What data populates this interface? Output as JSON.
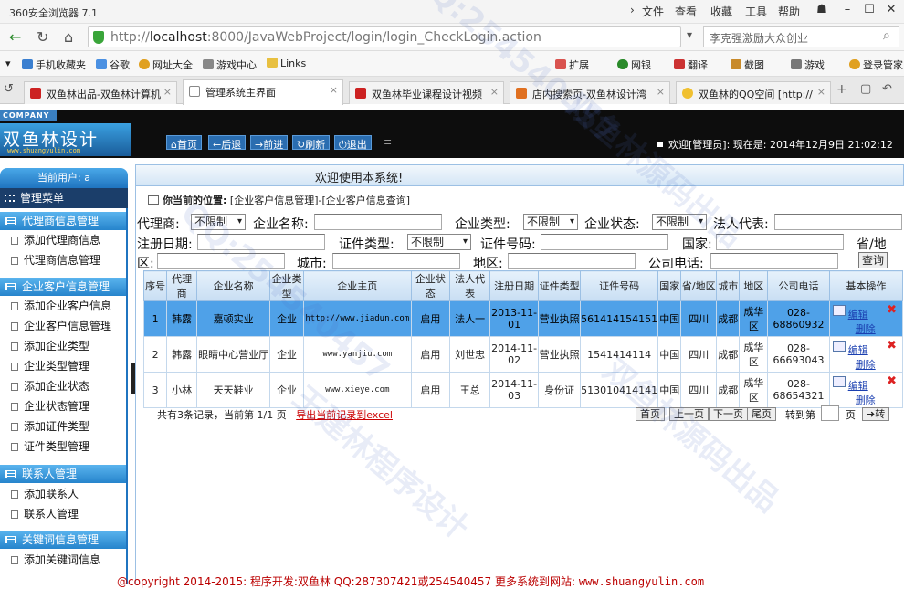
{
  "browser": {
    "title": "360安全浏览器 7.1",
    "menu": [
      "文件",
      "查看",
      "收藏",
      "工具",
      "帮助"
    ],
    "url_prefix": "http://",
    "url_host": "localhost",
    "url_rest": ":8000/JavaWebProject/login/login_CheckLogin.action",
    "search_text": "李克强激励大众创业",
    "bookmarks": [
      "手机收藏夹",
      "谷歌",
      "网址大全",
      "游戏中心",
      "Links"
    ],
    "tools": [
      "扩展",
      "网银",
      "翻译",
      "截图",
      "游戏",
      "登录管家"
    ],
    "tabs": [
      "双鱼林出品-双鱼林计算机",
      "管理系统主界面",
      "双鱼林毕业课程设计视频",
      "店内搜索页-双鱼林设计湾",
      "双鱼林的QQ空间 [http://"
    ]
  },
  "header": {
    "company": "COMPANY",
    "logo_text": "双鱼林设计",
    "logo_url": "www.shuangyulin.com",
    "nav": [
      "首页",
      "后退",
      "前进",
      "刷新",
      "退出"
    ],
    "welcome": "欢迎[管理员]:  现在是: 2014年12月9日 21:02:12"
  },
  "sidebar": {
    "current_user": "当前用户: a",
    "menu_title": "管理菜单",
    "sections": [
      {
        "title": "代理商信息管理",
        "items": [
          "添加代理商信息",
          "代理商信息管理"
        ]
      },
      {
        "title": "企业客户信息管理",
        "items": [
          "添加企业客户信息",
          "企业客户信息管理",
          "添加企业类型",
          "企业类型管理",
          "添加企业状态",
          "企业状态管理",
          "添加证件类型",
          "证件类型管理"
        ]
      },
      {
        "title": "联系人管理",
        "items": [
          "添加联系人",
          "联系人管理"
        ]
      },
      {
        "title": "关键词信息管理",
        "items": [
          "添加关键词信息"
        ]
      }
    ]
  },
  "main": {
    "welcome": "欢迎使用本系统!",
    "location_label": "你当前的位置:",
    "location_path": "[企业客户信息管理]-[企业客户信息查询]",
    "filters": {
      "agent": "代理商:",
      "agent_value": "不限制",
      "company_name": "企业名称:",
      "company_type": "企业类型:",
      "company_type_value": "不限制",
      "company_status": "企业状态:",
      "company_status_value": "不限制",
      "legal_rep": "法人代表:",
      "reg_date": "注册日期:",
      "id_type": "证件类型:",
      "id_type_value": "不限制",
      "id_number": "证件号码:",
      "country": "国家:",
      "province": "省/地",
      "province_tail": "区:",
      "city": "城市:",
      "district": "地区:",
      "phone": "公司电话:",
      "query": "查询"
    },
    "table": {
      "headers": [
        "序号",
        "代理商",
        "企业名称",
        "企业类型",
        "企业主页",
        "企业状态",
        "法人代表",
        "注册日期",
        "证件类型",
        "证件号码",
        "国家",
        "省/地区",
        "城市",
        "地区",
        "公司电话",
        "基本操作"
      ],
      "rows": [
        [
          "1",
          "韩露",
          "嘉顿实业",
          "企业",
          "http://www.jiadun.com",
          "启用",
          "法人一",
          "2013-11-01",
          "营业执照",
          "561414154151",
          "中国",
          "四川",
          "成都",
          "成华区",
          "028-68860932"
        ],
        [
          "2",
          "韩露",
          "眼睛中心营业厅",
          "企业",
          "www.yanjiu.com",
          "启用",
          "刘世忠",
          "2014-11-02",
          "营业执照",
          "1541414114",
          "中国",
          "四川",
          "成都",
          "成华区",
          "028-66693043"
        ],
        [
          "3",
          "小林",
          "天天鞋业",
          "企业",
          "www.xieye.com",
          "启用",
          "王总",
          "2014-11-03",
          "身份证",
          "513010414141",
          "中国",
          "四川",
          "成都",
          "成华区",
          "028-68654321"
        ]
      ],
      "edit": "编辑",
      "delete": "删除"
    },
    "pager": {
      "summary": "共有3条记录，当前第 1/1 页",
      "export": "导出当前记录到excel",
      "first": "首页",
      "prev": "上一页",
      "next": "下一页",
      "last": "尾页",
      "goto": "转到第",
      "page": "页",
      "go": "转"
    }
  },
  "footer": {
    "copyright": "@copyright 2014-2015: 程序开发:双鱼林  QQ:287307421或254540457  更多系统到网站: ",
    "site": "www.shuangyulin.com"
  },
  "watermarks": [
    "QQ:254540457",
    "双鱼林源码出品",
    "QQ:254540457",
    "王建林程序设计",
    "双鱼林源码出品"
  ]
}
